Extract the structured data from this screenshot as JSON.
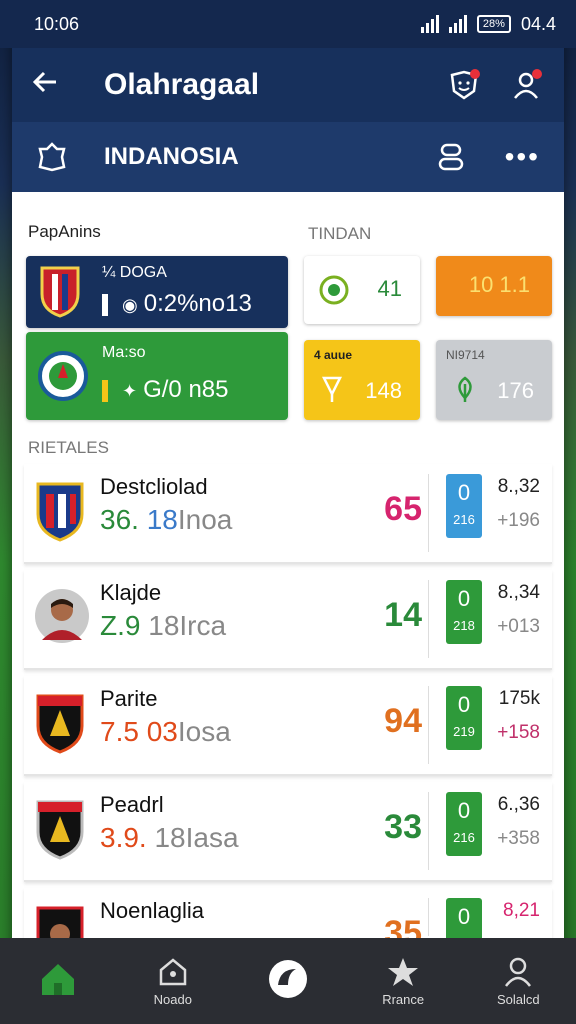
{
  "status": {
    "time": "10:06",
    "battery": "28%",
    "battery_right": "04.4"
  },
  "header": {
    "title": "Olahragaal",
    "back_icon": "back-arrow-icon"
  },
  "subheader": {
    "title": "INDANOSIA"
  },
  "sections": {
    "left": "PapAnins",
    "right": "TINDAN",
    "list": "RIETALES"
  },
  "tiles": {
    "team1": {
      "line1": "¼ DOGA",
      "line2": "0:2%no13"
    },
    "team2": {
      "line1": "Ma:so",
      "line2": "G/0 n85"
    },
    "small1": {
      "value": "41"
    },
    "small2": {
      "value": "10   1.1"
    },
    "small3": {
      "label": "4 auue",
      "value": "148"
    },
    "small4": {
      "label": "NI9714",
      "value": "176"
    }
  },
  "matches": [
    {
      "name": "Destcliolad",
      "sub_a": "36.",
      "sub_b": "18",
      "sub_c": "Inoa",
      "score": "65",
      "badge_top": "0",
      "badge_bot": "216",
      "odd1": "8.,32",
      "odd2": "+196",
      "score_color": "#d6246e",
      "sub_color": "#2a8a3a",
      "badge_color": "#3a9ad9",
      "odd2_color": "#888888"
    },
    {
      "name": "Klajde",
      "sub_a": "Z.9",
      "sub_b": "18",
      "sub_c": "Irca",
      "score": "14",
      "badge_top": "0",
      "badge_bot": "218",
      "odd1": "8.,34",
      "odd2": "+013",
      "score_color": "#2a8a3a",
      "sub_color": "#2a8a3a",
      "badge_color": "#2e9a3a",
      "odd2_color": "#888888"
    },
    {
      "name": "Parite",
      "sub_a": "7.5",
      "sub_b": "03",
      "sub_c": "Iosa",
      "score": "94",
      "badge_top": "0",
      "badge_bot": "219",
      "odd1": "175k",
      "odd2": "+158",
      "score_color": "#e07020",
      "sub_color": "#e04a1a",
      "badge_color": "#2e9a3a",
      "odd2_color": "#c0306a"
    },
    {
      "name": "Peadrl",
      "sub_a": "3.9.",
      "sub_b": "18",
      "sub_c": "Iasa",
      "score": "33",
      "badge_top": "0",
      "badge_bot": "216",
      "odd1": "6.,36",
      "odd2": "+358",
      "score_color": "#2a8a3a",
      "sub_color": "#e04a1a",
      "badge_color": "#2e9a3a",
      "odd2_color": "#888888"
    },
    {
      "name": "Noenlaglia",
      "sub_a": "",
      "sub_b": "",
      "sub_c": "",
      "score": "35",
      "badge_top": "0",
      "badge_bot": "",
      "odd1": "8,21",
      "odd2": "",
      "score_color": "#e07020",
      "sub_color": "#e04a1a",
      "badge_color": "#2e9a3a",
      "odd2_color": "#888888"
    }
  ],
  "nav": [
    {
      "label": "",
      "icon": "home-icon"
    },
    {
      "label": "Noado",
      "icon": "stadium-icon"
    },
    {
      "label": "",
      "icon": "ball-icon"
    },
    {
      "label": "Rrance",
      "icon": "star-icon"
    },
    {
      "label": "Solalcd",
      "icon": "profile-icon"
    }
  ],
  "colors": {
    "primary": "#17305c",
    "green": "#2e9a3a",
    "orange": "#f08a1a",
    "yellow": "#f5c518"
  }
}
